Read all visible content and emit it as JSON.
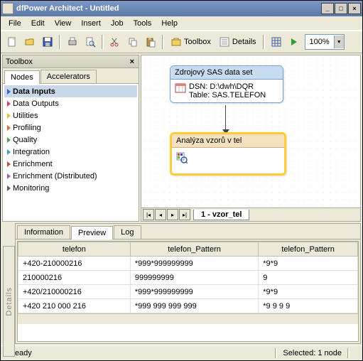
{
  "window": {
    "title": "dfPower Architect - Untitled"
  },
  "menu": {
    "items": [
      "File",
      "Edit",
      "View",
      "Insert",
      "Job",
      "Tools",
      "Help"
    ]
  },
  "toolbar": {
    "toolbox_label": "Toolbox",
    "details_label": "Details",
    "zoom": "100%"
  },
  "toolbox": {
    "title": "Toolbox",
    "tabs": [
      "Nodes",
      "Accelerators"
    ],
    "items": [
      {
        "label": "Data Inputs",
        "color": "#3366cc",
        "bold": true
      },
      {
        "label": "Data Outputs",
        "color": "#d04060"
      },
      {
        "label": "Utilities",
        "color": "#dcc040"
      },
      {
        "label": "Profiling",
        "color": "#d07030"
      },
      {
        "label": "Quality",
        "color": "#50a050"
      },
      {
        "label": "Integration",
        "color": "#40a0c0"
      },
      {
        "label": "Enrichment",
        "color": "#c05050"
      },
      {
        "label": "Enrichment (Distributed)",
        "color": "#a060c0"
      },
      {
        "label": "Monitoring",
        "color": "#606060"
      }
    ]
  },
  "canvas": {
    "src_title": "Zdrojový SAS data set",
    "src_line1": "DSN: D:\\dwh\\DQR",
    "src_line2": "Table: SAS.TELEFON",
    "tgt_title": "Analýza vzorů v tel",
    "tab": "1 - vzor_tel"
  },
  "details": {
    "side_label": "Details",
    "tabs": [
      "Information",
      "Preview",
      "Log"
    ],
    "cols": [
      "telefon",
      "telefon_Pattern",
      "telefon_Pattern"
    ],
    "rows": [
      [
        "+420-210000216",
        "*999*999999999",
        "*9*9"
      ],
      [
        "210000216",
        "999999999",
        "9"
      ],
      [
        "+420/210000216",
        "*999*999999999",
        "*9*9"
      ],
      [
        "+420 210 000 216",
        "*999 999 999 999",
        "*9 9 9 9"
      ]
    ]
  },
  "status": {
    "left": "Ready",
    "right": "Selected:  1 node"
  }
}
